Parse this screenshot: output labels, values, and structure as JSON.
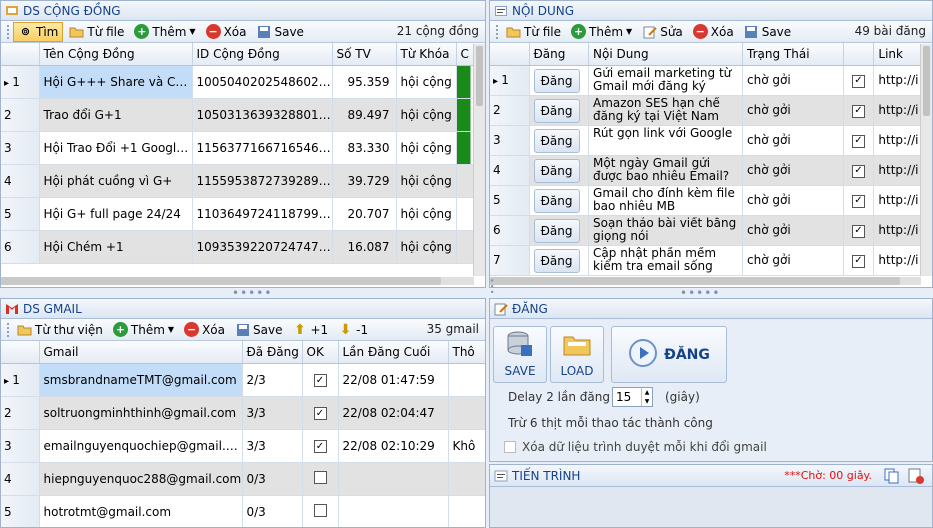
{
  "community": {
    "title": "DS CỘNG ĐỒNG",
    "toolbar": {
      "find": "Tìm",
      "from_file": "Từ file",
      "add": "Thêm",
      "delete": "Xóa",
      "save": "Save"
    },
    "count": "21 cộng đồng",
    "columns": [
      "Tên Cộng Đồng",
      "ID Cộng Đồng",
      "Số TV",
      "Từ Khóa",
      "C"
    ],
    "rows": [
      {
        "n": "1",
        "name": "Hội G+++ Share và Co...",
        "id": "10050402025486026263​8",
        "members": "95.359",
        "kw": "hội cộng"
      },
      {
        "n": "2",
        "name": "Trao đổi G+1",
        "id": "105031363932880125229",
        "members": "89.497",
        "kw": "hội cộng"
      },
      {
        "n": "3",
        "name": "Hội Trao Đổi +1 Google ...",
        "id": "115637716671654603221",
        "members": "83.330",
        "kw": "hội cộng"
      },
      {
        "n": "4",
        "name": "Hội phát cuồng vì G+",
        "id": "115595387273928997556",
        "members": "39.729",
        "kw": "hội cộng"
      },
      {
        "n": "5",
        "name": "Hội G+ full page 24/24",
        "id": "110364972411879964835",
        "members": "20.707",
        "kw": "hội cộng"
      },
      {
        "n": "6",
        "name": "Hội Chém +1",
        "id": "109353922072474798354",
        "members": "16.087",
        "kw": "hội cộng"
      }
    ]
  },
  "content": {
    "title": "NỘI DUNG",
    "toolbar": {
      "from_file": "Từ file",
      "add": "Thêm",
      "edit": "Sửa",
      "delete": "Xóa",
      "save": "Save"
    },
    "count": "49 bài đăng",
    "columns": [
      "Đăng",
      "Nội Dung",
      "Trạng Thái",
      "",
      "Link"
    ],
    "post_label": "Đăng",
    "rows": [
      {
        "n": "1",
        "text": "Gửi email marketing từ Gmail mới đăng ký",
        "status": "chờ gởi",
        "link": "http://i"
      },
      {
        "n": "2",
        "text": "Amazon SES hạn chế đăng ký tại Việt Nam",
        "status": "chờ gởi",
        "link": "http://i"
      },
      {
        "n": "3",
        "text": "Rút gọn link với Google",
        "status": "chờ gởi",
        "link": "http://i"
      },
      {
        "n": "4",
        "text": "Một ngày Gmail gửi được bao nhiêu Email?",
        "status": "chờ gởi",
        "link": "http://i"
      },
      {
        "n": "5",
        "text": "Gmail cho đính kèm file bao nhiêu MB",
        "status": "chờ gởi",
        "link": "http://i"
      },
      {
        "n": "6",
        "text": "Soạn thảo bài viết bằng giọng nói",
        "status": "chờ gởi",
        "link": "http://i"
      },
      {
        "n": "7",
        "text": "Cập nhật phần mềm kiểm tra email sống Verify",
        "status": "chờ gởi",
        "link": "http://i"
      }
    ]
  },
  "gmail": {
    "title": "DS GMAIL",
    "toolbar": {
      "from_lib": "Từ thư viện",
      "add": "Thêm",
      "delete": "Xóa",
      "save": "Save",
      "plus": "+1",
      "minus": "-1"
    },
    "count": "35 gmail",
    "columns": [
      "Gmail",
      "Đã Đăng",
      "OK",
      "Lần Đăng Cuối",
      "Thô"
    ],
    "rows": [
      {
        "n": "1",
        "email": "smsbrandnameTMT@gmail.com",
        "posted": "2/3",
        "ok": true,
        "last": "22/08 01:47:59",
        "extra": ""
      },
      {
        "n": "2",
        "email": "soltruongminhthinh@gmail.com",
        "posted": "3/3",
        "ok": true,
        "last": "22/08 02:04:47",
        "extra": ""
      },
      {
        "n": "3",
        "email": "emailnguyenquochiep@gmail.com",
        "posted": "3/3",
        "ok": true,
        "last": "22/08 02:10:29",
        "extra": "Khô"
      },
      {
        "n": "4",
        "email": "hiepnguyenquoc288@gmail.com",
        "posted": "0/3",
        "ok": false,
        "last": "",
        "extra": ""
      },
      {
        "n": "5",
        "email": "hotrotmt@gmail.com",
        "posted": "0/3",
        "ok": false,
        "last": "",
        "extra": ""
      }
    ]
  },
  "post": {
    "title": "ĐĂNG",
    "save": "SAVE",
    "load": "LOAD",
    "post_button": "ĐĂNG",
    "delay_label": "Delay 2 lần đăng",
    "delay_value": "15",
    "delay_unit": "(giây)",
    "note": "Trừ 6 thịt mỗi thao tác thành công",
    "clear_label": "Xóa dữ liệu trình duyệt mỗi khi đổi gmail"
  },
  "progress": {
    "title": "TIẾN TRÌNH",
    "status": "***Chờ: 00 giây."
  }
}
